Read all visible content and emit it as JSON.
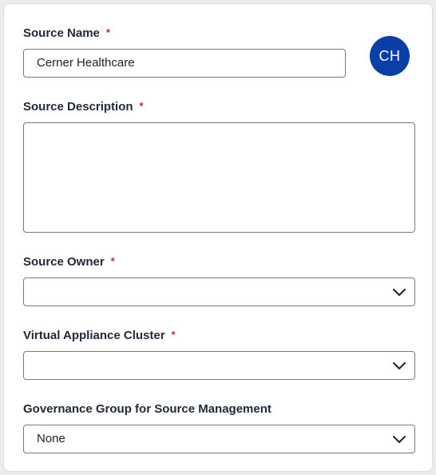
{
  "form": {
    "source_name": {
      "label": "Source Name",
      "required_mark": "*",
      "value": "Cerner Healthcare"
    },
    "avatar_initials": "CH",
    "source_description": {
      "label": "Source Description",
      "required_mark": "*",
      "value": ""
    },
    "source_owner": {
      "label": "Source Owner",
      "required_mark": "*",
      "value": ""
    },
    "virtual_appliance_cluster": {
      "label": "Virtual Appliance Cluster",
      "required_mark": "*",
      "value": ""
    },
    "governance_group": {
      "label": "Governance Group for Source Management",
      "value": "None"
    }
  },
  "colors": {
    "avatar_bg": "#0a3ea8",
    "required": "#c0253d",
    "label": "#1f2937"
  },
  "icons": {
    "dropdown": "chevron-down-icon"
  }
}
